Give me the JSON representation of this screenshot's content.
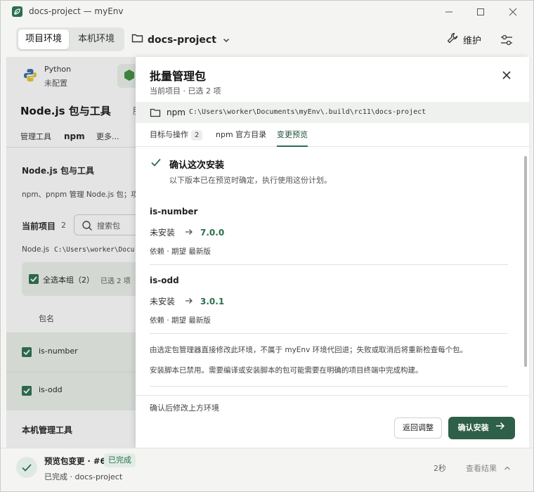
{
  "window": {
    "title": "docs-project — myEnv",
    "app_icon": "leaf-icon"
  },
  "toolbar": {
    "segments": [
      {
        "label": "项目环境",
        "active": true
      },
      {
        "label": "本机环境",
        "active": false
      }
    ],
    "project": "docs-project",
    "maintain": "维护"
  },
  "background": {
    "runtime_python": "Python",
    "runtime_python_status": "未配置",
    "page_title": "Node.js 包与工具",
    "page_title_more": "服",
    "tabs": [
      "管理工具",
      "npm",
      "更多..."
    ],
    "section_title": "Node.js 包与工具",
    "section_desc": "npm、pnpm 管理 Node.js 包；项",
    "current_items_label": "当前项目",
    "current_items_count": "2",
    "search_placeholder": "搜索包",
    "path_label": "Node.js",
    "path_value": "C:\\Users\\worker\\Docu",
    "select_group": "全选本组（2）",
    "selected_count": "已选 2 项",
    "col_header": "包名",
    "rows": [
      "is-number",
      "is-odd"
    ],
    "local_tools_title": "本机管理工具"
  },
  "drawer": {
    "title": "批量管理包",
    "subtitle": "当前项目 · 已选 2 项",
    "manager": "npm",
    "path": "C:\\Users\\worker\\Documents\\myEnv\\.build\\rc11\\docs-project",
    "tabs": [
      {
        "label": "目标与操作",
        "count": "2"
      },
      {
        "label": "npm 官方目录"
      },
      {
        "label": "变更预览"
      }
    ],
    "confirm_heading": "确认这次安装",
    "confirm_sub": "以下版本已在预览时确定，执行使用这份计划。",
    "packages": [
      {
        "name": "is-number",
        "from": "未安装",
        "to": "7.0.0",
        "dep": "依赖 · 期望 最新版"
      },
      {
        "name": "is-odd",
        "from": "未安装",
        "to": "3.0.1",
        "dep": "依赖 · 期望 最新版"
      }
    ],
    "note1": "由选定包管理器直接修改此环境，不属于 myEnv 环境代回退；失败或取消后将重新检查每个包。",
    "note2": "安装脚本已禁用。需要编译或安装脚本的包可能需要在明确的项目终端中完成构建。",
    "footer_note": "确认后修改上方环境",
    "back_button": "返回调整",
    "confirm_button": "确认安装"
  },
  "status": {
    "title": "预览包变更 · #6",
    "badge": "已完成",
    "sub": "已完成 · docs-project",
    "time": "2秒",
    "view": "查看结果"
  }
}
